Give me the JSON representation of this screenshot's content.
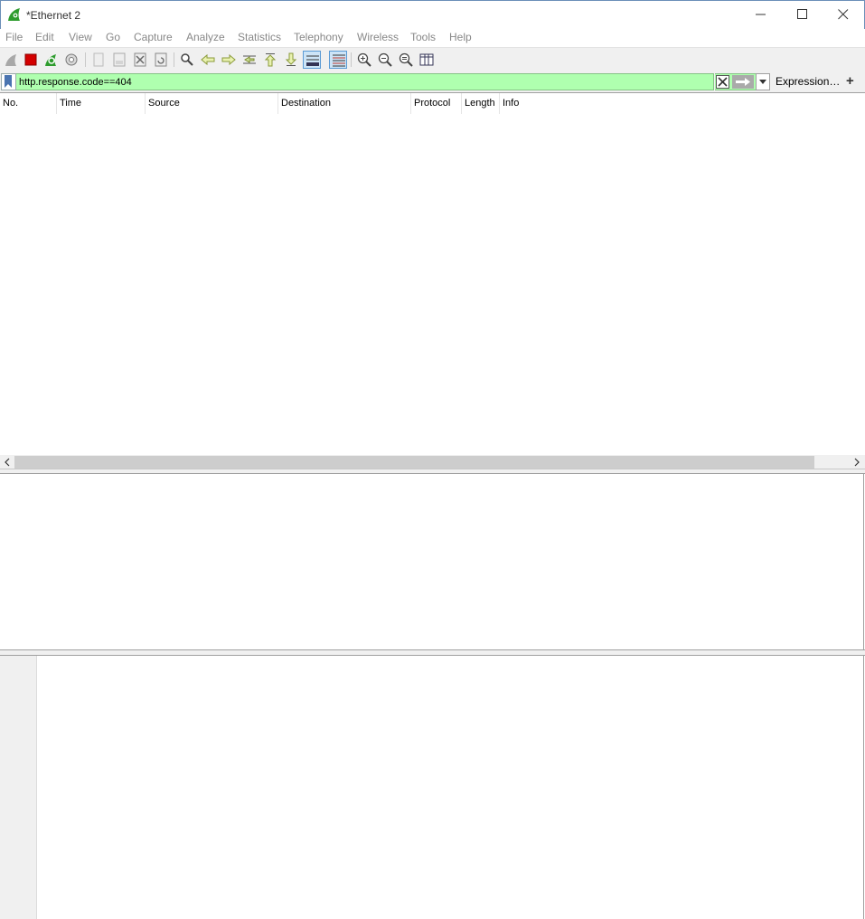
{
  "window": {
    "title": "*Ethernet 2"
  },
  "menu": [
    "File",
    "Edit",
    "View",
    "Go",
    "Capture",
    "Analyze",
    "Statistics",
    "Telephony",
    "Wireless",
    "Tools",
    "Help"
  ],
  "toolbar": {
    "icons": [
      "shark-fin-start-icon",
      "stop-square-icon",
      "restart-capture-icon",
      "capture-options-gear-icon",
      "open-file-icon",
      "save-file-icon",
      "close-file-icon",
      "reload-file-icon",
      "find-packet-icon",
      "go-back-icon",
      "go-forward-icon",
      "go-to-packet-icon",
      "go-first-icon",
      "go-last-icon",
      "autoscroll-icon",
      "colorize-icon",
      "zoom-in-icon",
      "zoom-out-icon",
      "zoom-normal-icon",
      "resize-columns-icon"
    ],
    "checked": [
      "autoscroll-icon",
      "colorize-icon"
    ]
  },
  "filter": {
    "value": "http.response.code==404",
    "expression_label": "Expression…",
    "add_label": "+",
    "valid_color": "#afffaf"
  },
  "packet_list": {
    "columns": [
      "No.",
      "Time",
      "Source",
      "Destination",
      "Protocol",
      "Length",
      "Info"
    ],
    "rows": []
  },
  "colors": {
    "accent": "#2e9c2e",
    "stop_red": "#d40000"
  }
}
